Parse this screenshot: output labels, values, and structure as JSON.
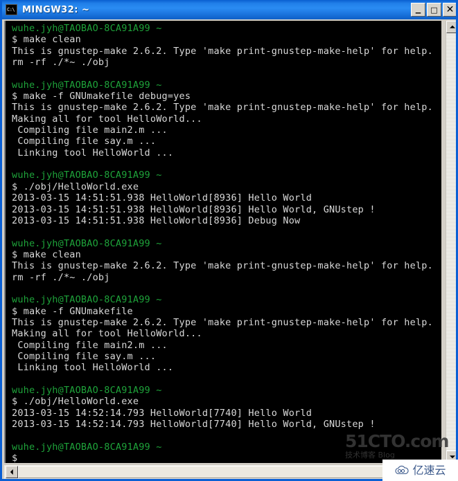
{
  "window": {
    "title": "MINGW32: ~",
    "icon": "console-icon",
    "buttons": {
      "minimize": "_",
      "maximize": "□",
      "close": "✕"
    }
  },
  "terminal": {
    "prompt_color": "#1ea33a",
    "text_color": "#d9d9d9",
    "background": "#000000",
    "lines": [
      {
        "text": "wuhe.jyh@TAOBAO-8CA91A99 ~",
        "style": "green"
      },
      {
        "text": "$ make clean",
        "style": "white"
      },
      {
        "text": "This is gnustep-make 2.6.2. Type 'make print-gnustep-make-help' for help.",
        "style": "white"
      },
      {
        "text": "rm -rf ./*~ ./obj",
        "style": "white"
      },
      {
        "text": "",
        "style": "blank"
      },
      {
        "text": "wuhe.jyh@TAOBAO-8CA91A99 ~",
        "style": "green"
      },
      {
        "text": "$ make -f GNUmakefile debug=yes",
        "style": "white"
      },
      {
        "text": "This is gnustep-make 2.6.2. Type 'make print-gnustep-make-help' for help.",
        "style": "white"
      },
      {
        "text": "Making all for tool HelloWorld...",
        "style": "white"
      },
      {
        "text": " Compiling file main2.m ...",
        "style": "white"
      },
      {
        "text": " Compiling file say.m ...",
        "style": "white"
      },
      {
        "text": " Linking tool HelloWorld ...",
        "style": "white"
      },
      {
        "text": "",
        "style": "blank"
      },
      {
        "text": "wuhe.jyh@TAOBAO-8CA91A99 ~",
        "style": "green"
      },
      {
        "text": "$ ./obj/HelloWorld.exe",
        "style": "white"
      },
      {
        "text": "2013-03-15 14:51:51.938 HelloWorld[8936] Hello World",
        "style": "white"
      },
      {
        "text": "2013-03-15 14:51:51.938 HelloWorld[8936] Hello World, GNUstep !",
        "style": "white"
      },
      {
        "text": "2013-03-15 14:51:51.938 HelloWorld[8936] Debug Now",
        "style": "white"
      },
      {
        "text": "",
        "style": "blank"
      },
      {
        "text": "wuhe.jyh@TAOBAO-8CA91A99 ~",
        "style": "green"
      },
      {
        "text": "$ make clean",
        "style": "white"
      },
      {
        "text": "This is gnustep-make 2.6.2. Type 'make print-gnustep-make-help' for help.",
        "style": "white"
      },
      {
        "text": "rm -rf ./*~ ./obj",
        "style": "white"
      },
      {
        "text": "",
        "style": "blank"
      },
      {
        "text": "wuhe.jyh@TAOBAO-8CA91A99 ~",
        "style": "green"
      },
      {
        "text": "$ make -f GNUmakefile",
        "style": "white"
      },
      {
        "text": "This is gnustep-make 2.6.2. Type 'make print-gnustep-make-help' for help.",
        "style": "white"
      },
      {
        "text": "Making all for tool HelloWorld...",
        "style": "white"
      },
      {
        "text": " Compiling file main2.m ...",
        "style": "white"
      },
      {
        "text": " Compiling file say.m ...",
        "style": "white"
      },
      {
        "text": " Linking tool HelloWorld ...",
        "style": "white"
      },
      {
        "text": "",
        "style": "blank"
      },
      {
        "text": "wuhe.jyh@TAOBAO-8CA91A99 ~",
        "style": "green"
      },
      {
        "text": "$ ./obj/HelloWorld.exe",
        "style": "white"
      },
      {
        "text": "2013-03-15 14:52:14.793 HelloWorld[7740] Hello World",
        "style": "white"
      },
      {
        "text": "2013-03-15 14:52:14.793 HelloWorld[7740] Hello World, GNUstep !",
        "style": "white"
      },
      {
        "text": "",
        "style": "blank"
      },
      {
        "text": "wuhe.jyh@TAOBAO-8CA91A99 ~",
        "style": "green"
      },
      {
        "text": "$",
        "style": "white"
      }
    ]
  },
  "scrollbars": {
    "vertical": {
      "up_arrow": "scroll-up",
      "down_arrow": "scroll-down"
    },
    "horizontal": {
      "left_arrow": "scroll-left"
    }
  },
  "watermarks": {
    "cto": {
      "main": "51CTO.com",
      "sub": "技术博客  Blog"
    },
    "yisuyun": {
      "label": "亿速云",
      "icon": "cloud-icon"
    }
  }
}
